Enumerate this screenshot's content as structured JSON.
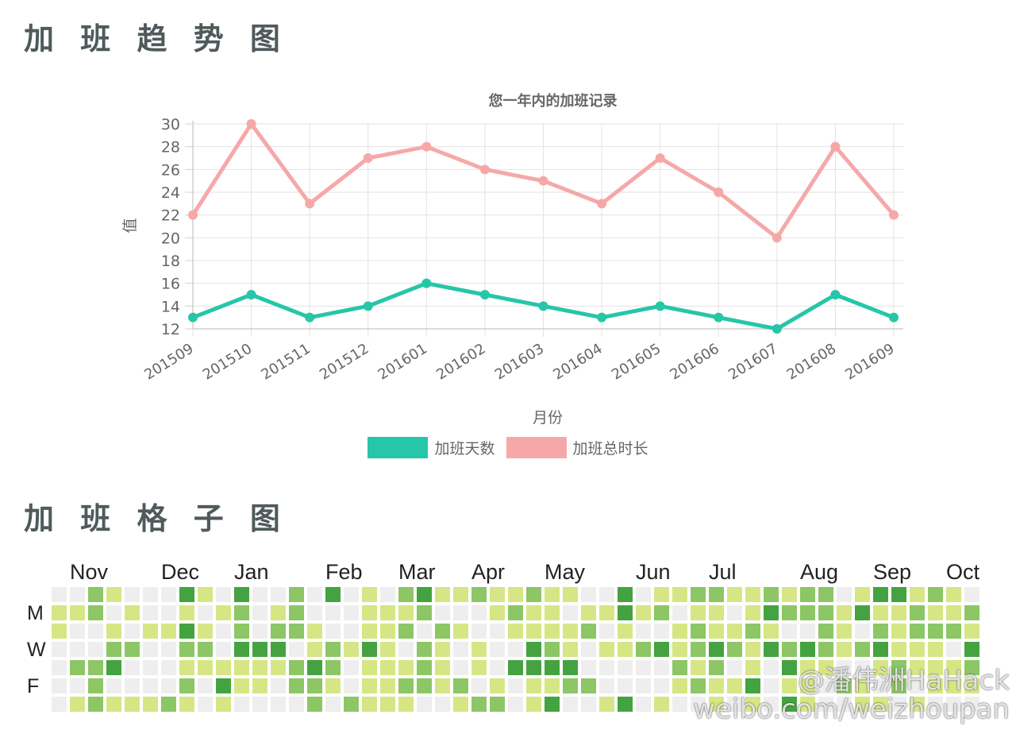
{
  "sections": {
    "trend_title": "加 班 趋 势 图",
    "grid_title": "加 班 格 子 图"
  },
  "chart_data": {
    "type": "line",
    "title": "您一年内的加班记录",
    "xlabel": "月份",
    "ylabel": "值",
    "categories": [
      "201509",
      "201510",
      "201511",
      "201512",
      "201601",
      "201602",
      "201603",
      "201604",
      "201605",
      "201606",
      "201607",
      "201608",
      "201609"
    ],
    "ylim": [
      12,
      30
    ],
    "yticks": [
      12,
      14,
      16,
      18,
      20,
      22,
      24,
      26,
      28,
      30
    ],
    "grid": true,
    "legend_position": "bottom",
    "series": [
      {
        "name": "加班天数",
        "color": "#26c6a8",
        "values": [
          13,
          15,
          13,
          14,
          16,
          15,
          14,
          13,
          14,
          13,
          12,
          15,
          13
        ]
      },
      {
        "name": "加班总时长",
        "color": "#f6a8a8",
        "values": [
          22,
          30,
          23,
          27,
          28,
          26,
          25,
          23,
          27,
          24,
          20,
          28,
          22
        ]
      }
    ]
  },
  "heatmap": {
    "month_labels": [
      "Nov",
      "Dec",
      "Jan",
      "Feb",
      "Mar",
      "Apr",
      "May",
      "Jun",
      "Jul",
      "Aug",
      "Sep",
      "Oct"
    ],
    "month_start_weeks": [
      1,
      6,
      10,
      15,
      19,
      23,
      27,
      32,
      36,
      41,
      45,
      49
    ],
    "day_labels": [
      "",
      "M",
      "",
      "W",
      "",
      "F",
      ""
    ],
    "colors": [
      "#eeeeee",
      "#d6e685",
      "#8cc665",
      "#44a340"
    ],
    "weeks": [
      [
        0,
        1,
        1,
        0,
        0,
        0,
        0
      ],
      [
        0,
        1,
        0,
        0,
        2,
        0,
        1
      ],
      [
        2,
        2,
        0,
        0,
        2,
        2,
        2
      ],
      [
        1,
        0,
        1,
        2,
        3,
        0,
        1
      ],
      [
        0,
        1,
        0,
        2,
        0,
        0,
        1
      ],
      [
        0,
        0,
        1,
        0,
        0,
        0,
        1
      ],
      [
        0,
        0,
        1,
        0,
        0,
        0,
        2
      ],
      [
        3,
        1,
        3,
        2,
        1,
        2,
        1
      ],
      [
        1,
        0,
        1,
        2,
        1,
        0,
        0
      ],
      [
        0,
        1,
        0,
        0,
        1,
        3,
        1
      ],
      [
        3,
        2,
        2,
        3,
        1,
        1,
        0
      ],
      [
        0,
        0,
        0,
        3,
        1,
        1,
        0
      ],
      [
        0,
        1,
        2,
        3,
        1,
        0,
        0
      ],
      [
        2,
        2,
        2,
        0,
        2,
        2,
        0
      ],
      [
        0,
        0,
        1,
        1,
        3,
        2,
        2
      ],
      [
        3,
        0,
        0,
        2,
        2,
        1,
        0
      ],
      [
        0,
        0,
        0,
        1,
        0,
        0,
        2
      ],
      [
        1,
        1,
        1,
        3,
        1,
        1,
        1
      ],
      [
        0,
        1,
        1,
        1,
        1,
        1,
        1
      ],
      [
        2,
        1,
        2,
        0,
        1,
        2,
        1
      ],
      [
        3,
        2,
        0,
        2,
        2,
        2,
        0
      ],
      [
        1,
        0,
        2,
        1,
        1,
        1,
        0
      ],
      [
        1,
        0,
        1,
        0,
        0,
        2,
        1
      ],
      [
        2,
        0,
        0,
        1,
        1,
        0,
        2
      ],
      [
        1,
        1,
        0,
        0,
        0,
        1,
        2
      ],
      [
        1,
        2,
        1,
        0,
        3,
        0,
        0
      ],
      [
        2,
        1,
        1,
        3,
        3,
        1,
        1
      ],
      [
        1,
        1,
        1,
        2,
        3,
        1,
        3
      ],
      [
        1,
        0,
        1,
        1,
        3,
        2,
        0
      ],
      [
        0,
        1,
        2,
        0,
        0,
        2,
        0
      ],
      [
        0,
        1,
        0,
        1,
        0,
        0,
        1
      ],
      [
        3,
        3,
        1,
        1,
        0,
        0,
        3
      ],
      [
        0,
        1,
        0,
        2,
        0,
        0,
        0
      ],
      [
        1,
        2,
        0,
        3,
        0,
        0,
        1
      ],
      [
        1,
        0,
        1,
        1,
        2,
        1,
        0
      ],
      [
        2,
        1,
        2,
        2,
        1,
        2,
        0
      ],
      [
        2,
        1,
        1,
        3,
        2,
        1,
        1
      ],
      [
        1,
        0,
        1,
        2,
        0,
        1,
        0
      ],
      [
        1,
        1,
        2,
        1,
        1,
        3,
        1
      ],
      [
        2,
        3,
        1,
        3,
        0,
        0,
        0
      ],
      [
        1,
        2,
        0,
        2,
        3,
        1,
        3
      ],
      [
        2,
        2,
        0,
        3,
        1,
        1,
        1
      ],
      [
        2,
        2,
        2,
        2,
        1,
        0,
        0
      ],
      [
        0,
        1,
        1,
        1,
        0,
        2,
        0
      ],
      [
        1,
        3,
        0,
        2,
        0,
        1,
        1
      ],
      [
        3,
        1,
        2,
        3,
        1,
        0,
        1
      ],
      [
        3,
        1,
        1,
        1,
        2,
        2,
        0
      ],
      [
        1,
        2,
        2,
        1,
        1,
        0,
        1
      ],
      [
        2,
        1,
        2,
        1,
        1,
        1,
        0
      ],
      [
        1,
        1,
        2,
        0,
        1,
        1,
        0
      ],
      [
        0,
        2,
        1,
        3,
        2,
        1,
        0
      ]
    ]
  },
  "watermark": {
    "line1": "@潘伟洲HaHack",
    "line2": "weibo.com/weizhoupan"
  }
}
